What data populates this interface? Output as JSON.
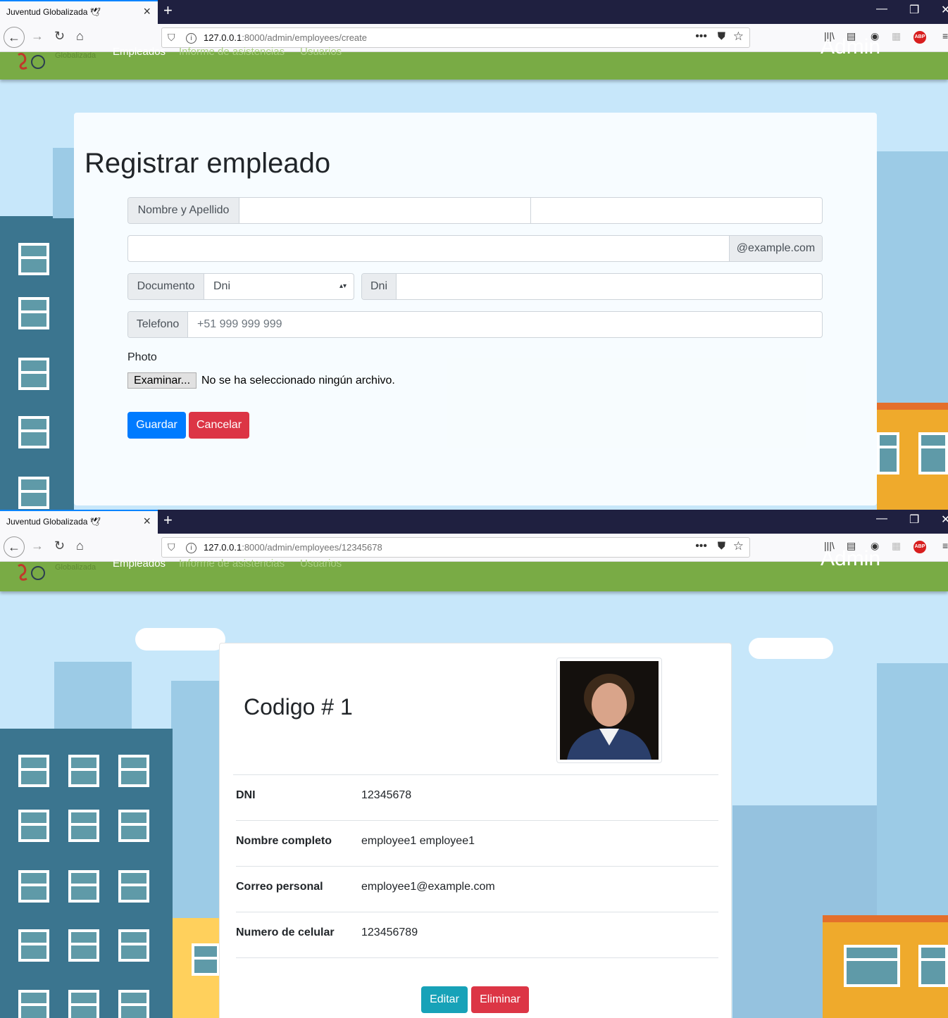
{
  "windows": [
    {
      "tab_title": "Juventud Globalizada 🕊",
      "url_host": "127.0.0.1",
      "url_rest": ":8000/admin/employees/create"
    },
    {
      "tab_title": "Juventud Globalizada 🕊",
      "url_host": "127.0.0.1",
      "url_rest": ":8000/admin/employees/12345678"
    }
  ],
  "site": {
    "logo_text": "Globalizada",
    "nav": [
      "Empleados",
      "Informe de asistencias",
      "Usuarios"
    ],
    "admin": "Admin"
  },
  "create_form": {
    "title": "Registrar empleado",
    "name_label": "Nombre y Apellido",
    "email_suffix": "@example.com",
    "doc_label": "Documento",
    "doc_selected": "Dni",
    "doc_number_label": "Dni",
    "phone_label": "Telefono",
    "phone_placeholder": "+51 999 999 999",
    "photo_label": "Photo",
    "file_button": "Examinar...",
    "file_status": "No se ha seleccionado ningún archivo.",
    "save": "Guardar",
    "cancel": "Cancelar"
  },
  "employee": {
    "code_title": "Codigo # 1",
    "rows": [
      {
        "label": "DNI",
        "value": "12345678"
      },
      {
        "label": "Nombre completo",
        "value": "employee1 employee1"
      },
      {
        "label": "Correo personal",
        "value": "employee1@example.com"
      },
      {
        "label": "Numero de celular",
        "value": "123456789"
      }
    ],
    "edit": "Editar",
    "delete": "Eliminar"
  },
  "colors": {
    "nav_green": "#79ab45",
    "primary": "#007bff",
    "danger": "#dc3545",
    "info": "#17a2b8",
    "sky": "#c7e7fa"
  }
}
